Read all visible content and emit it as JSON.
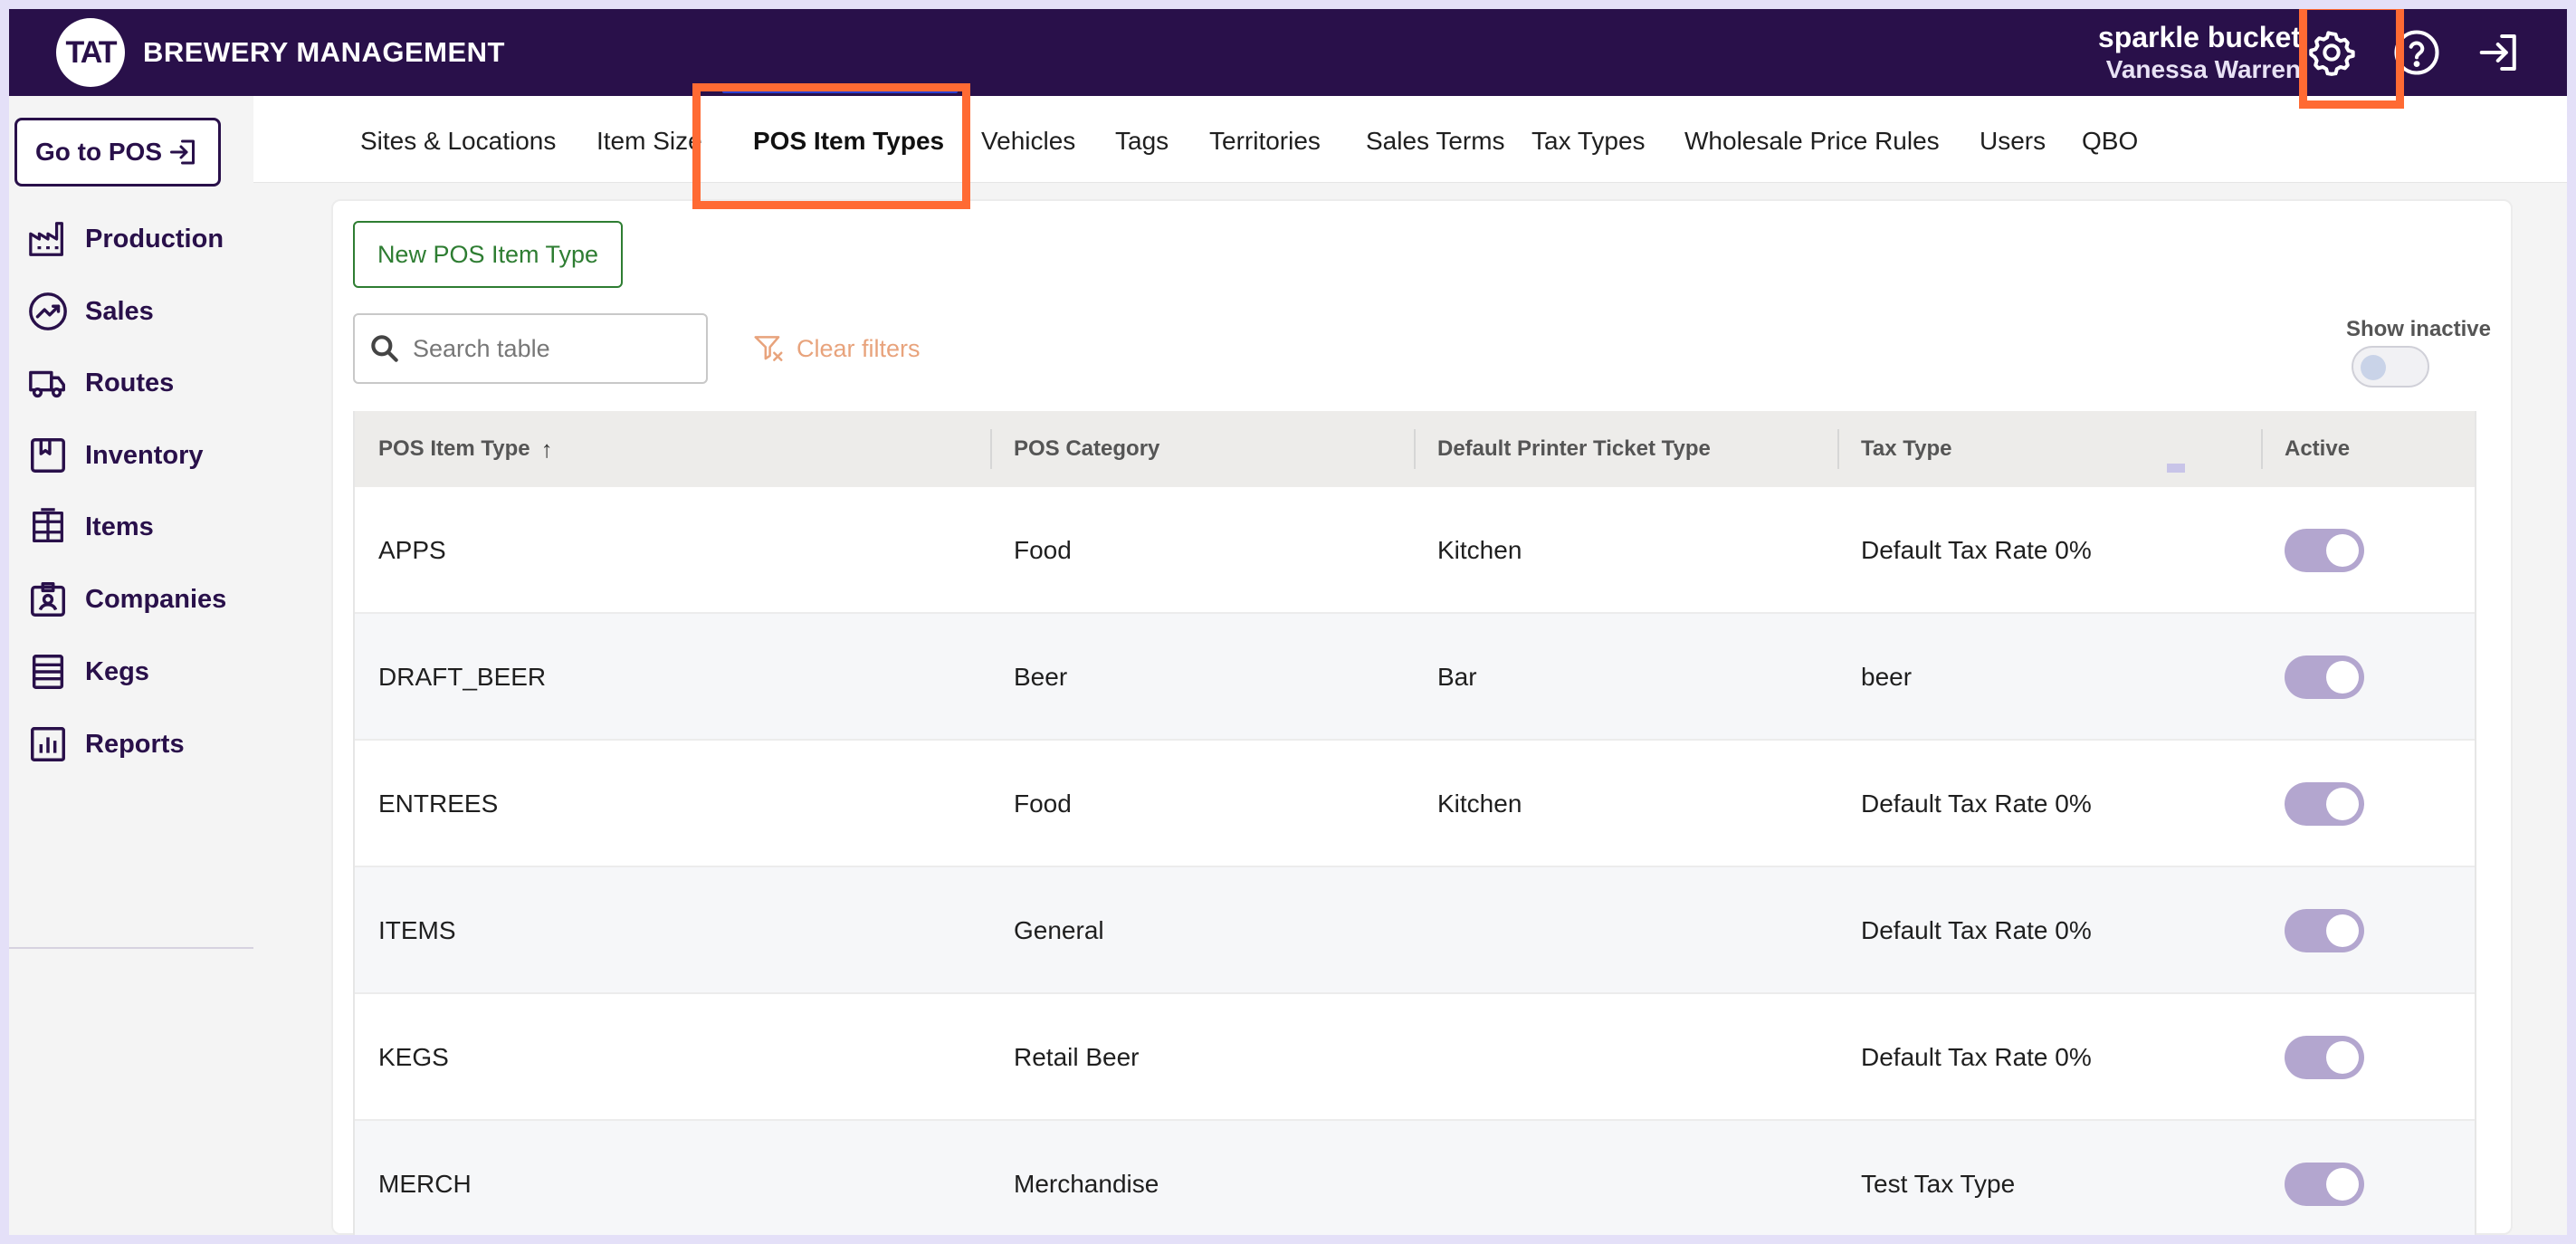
{
  "header": {
    "logo_text": "TAT",
    "app_title": "BREWERY MANAGEMENT",
    "company": "sparkle bucket",
    "user_name": "Vanessa Warren"
  },
  "sidebar": {
    "pos_button": "Go to POS",
    "items": [
      {
        "label": "Production",
        "icon": "factory-icon"
      },
      {
        "label": "Sales",
        "icon": "trending-up-icon"
      },
      {
        "label": "Routes",
        "icon": "truck-icon"
      },
      {
        "label": "Inventory",
        "icon": "bookmark-box-icon"
      },
      {
        "label": "Items",
        "icon": "barrel-icon"
      },
      {
        "label": "Companies",
        "icon": "contact-badge-icon"
      },
      {
        "label": "Kegs",
        "icon": "keg-icon"
      },
      {
        "label": "Reports",
        "icon": "bar-chart-icon"
      }
    ]
  },
  "tabs": [
    "Sites & Locations",
    "Item Size",
    "POS Item Types",
    "Vehicles",
    "Tags",
    "Territories",
    "Sales Terms",
    "Tax Types",
    "Wholesale Price Rules",
    "Users",
    "QBO"
  ],
  "active_tab": "POS Item Types",
  "toolbar": {
    "new_button": "New POS Item Type",
    "search_placeholder": "Search table",
    "clear_filters": "Clear filters",
    "show_inactive": "Show inactive"
  },
  "table": {
    "columns": [
      "POS Item Type",
      "POS Category",
      "Default Printer Ticket Type",
      "Tax Type",
      "Active"
    ],
    "sort_indicator": "↑",
    "rows": [
      {
        "type": "APPS",
        "category": "Food",
        "printer": "Kitchen",
        "tax": "Default Tax Rate 0%",
        "active": true
      },
      {
        "type": "DRAFT_BEER",
        "category": "Beer",
        "printer": "Bar",
        "tax": "beer",
        "active": true
      },
      {
        "type": "ENTREES",
        "category": "Food",
        "printer": "Kitchen",
        "tax": "Default Tax Rate 0%",
        "active": true
      },
      {
        "type": "ITEMS",
        "category": "General",
        "printer": "",
        "tax": "Default Tax Rate 0%",
        "active": true
      },
      {
        "type": "KEGS",
        "category": "Retail Beer",
        "printer": "",
        "tax": "Default Tax Rate 0%",
        "active": true
      },
      {
        "type": "MERCH",
        "category": "Merchandise",
        "printer": "",
        "tax": "Test Tax Type",
        "active": true
      }
    ]
  },
  "colors": {
    "header_bg": "#29104a",
    "highlight": "#ff6a33",
    "tab_underline": "#2a3fd1",
    "new_button": "#2e7d32",
    "toggle_on": "#b3a6cf"
  }
}
